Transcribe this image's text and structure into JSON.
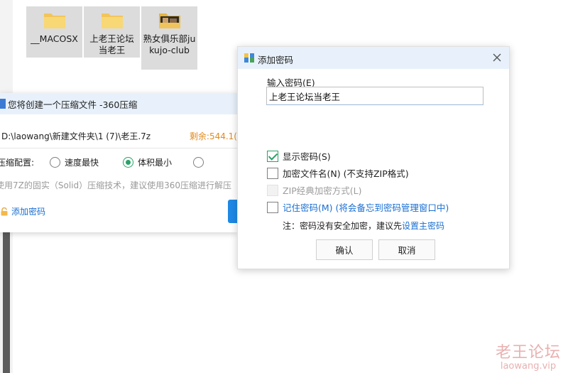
{
  "files": [
    {
      "name": "__MACOSX",
      "icon": "folder-icon"
    },
    {
      "name": "上老王论坛当老王",
      "icon": "folder-icon"
    },
    {
      "name": "熟女俱乐部jukujo-club",
      "icon": "folder-thumbnail-icon"
    }
  ],
  "compress_dialog": {
    "title": "您将创建一个压缩文件 -360压缩",
    "path": "D:\\laowang\\新建文件夹\\1 (7)\\老王.7z",
    "remaining": "剩余:544.1(",
    "config_label": "压缩配置:",
    "options": [
      {
        "label": "速度最快",
        "selected": false
      },
      {
        "label": "体积最小",
        "selected": true
      }
    ],
    "hint": "使用7Z的固实（Solid）压缩技术，建议使用360压缩进行解压",
    "add_password": "添加密码"
  },
  "password_dialog": {
    "title": "添加密码",
    "input_label": "输入密码(E)",
    "password_value": "上老王论坛当老王",
    "checkboxes": [
      {
        "label": "显示密码(S)",
        "checked": true,
        "disabled": false,
        "link": false
      },
      {
        "label": "加密文件名(N) (不支持ZIP格式)",
        "checked": false,
        "disabled": false,
        "link": false
      },
      {
        "label": "ZIP经典加密方式(L)",
        "checked": false,
        "disabled": true,
        "link": false
      },
      {
        "label": "记住密码(M) (将会备忘到密码管理窗口中)",
        "checked": false,
        "disabled": false,
        "link": true
      }
    ],
    "note_prefix": "注：密码没有安全加密，建议先",
    "note_link": "设置主密码",
    "ok": "确认",
    "cancel": "取消"
  },
  "watermark": {
    "title": "老王论坛",
    "url": "laowang.vip"
  },
  "colors": {
    "accent": "#1a6fd1",
    "check": "#2aa267",
    "warning": "#e08a1e",
    "titlebar": "#e8f1fb"
  }
}
